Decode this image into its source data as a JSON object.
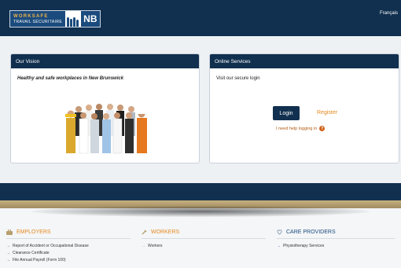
{
  "header": {
    "logo_line1": "WORKSAFE",
    "logo_line2": "TRAVAIL SÉCURITAIRE",
    "logo_nb": "NB",
    "language_link": "Français"
  },
  "vision": {
    "title": "Our Vision",
    "tagline": "Healthy and safe workplaces in New Brunswick"
  },
  "online": {
    "title": "Online Services",
    "subtitle": "Visit our secure login",
    "login_label": "Login",
    "register_label": "Register",
    "help_label": "I need help logging in",
    "help_icon": "question-icon"
  },
  "columns": {
    "employers": {
      "title": "EMPLOYERS",
      "icon": "employers-icon",
      "items": [
        "Report of Accident or Occupational Disease",
        "Clearance Certificate",
        "File Annual Payroll (Form 100)"
      ]
    },
    "workers": {
      "title": "WORKERS",
      "icon": "workers-icon",
      "items": [
        "Workers"
      ]
    },
    "care": {
      "title": "CARE PROVIDERS",
      "icon": "care-icon",
      "items": [
        "Physiotherapy Services"
      ]
    }
  },
  "colors": {
    "navy": "#11304f",
    "orange": "#e58a20",
    "gold": "#b79f6e"
  }
}
